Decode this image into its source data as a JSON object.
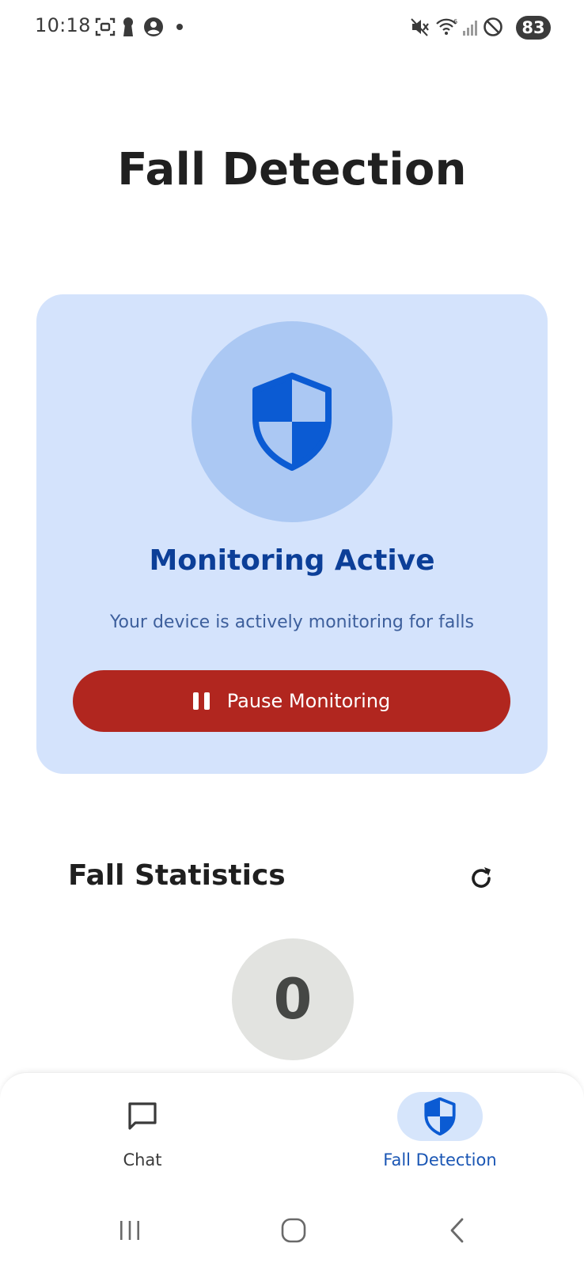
{
  "status_bar": {
    "time": "10:18",
    "battery": "83",
    "icons": [
      "screenshot-icon",
      "keyhole-icon",
      "account-circle-icon",
      "dot-icon",
      "mute-icon",
      "wifi-icon",
      "signal-icon",
      "do-not-disturb-icon"
    ]
  },
  "page": {
    "title": "Fall Detection"
  },
  "status_card": {
    "icon": "shield-icon",
    "title": "Monitoring Active",
    "subtitle": "Your device is actively monitoring for falls",
    "pause_button_label": "Pause Monitoring",
    "pause_icon": "pause-icon"
  },
  "stats": {
    "title": "Fall Statistics",
    "refresh_icon": "refresh-icon",
    "count": "0"
  },
  "bottom_nav": {
    "items": [
      {
        "label": "Chat",
        "icon": "chat-icon",
        "active": false
      },
      {
        "label": "Fall Detection",
        "icon": "shield-icon",
        "active": true
      }
    ]
  },
  "system_nav": {
    "icons": [
      "recents-icon",
      "home-icon",
      "back-icon"
    ]
  },
  "colors": {
    "card_bg": "#d4e3fc",
    "circle_bg": "#abc8f3",
    "accent_blue": "#0c3f98",
    "shield_blue": "#0b5bd3",
    "pause_red": "#b1261f",
    "active_nav_bg": "#d6e5fb"
  }
}
